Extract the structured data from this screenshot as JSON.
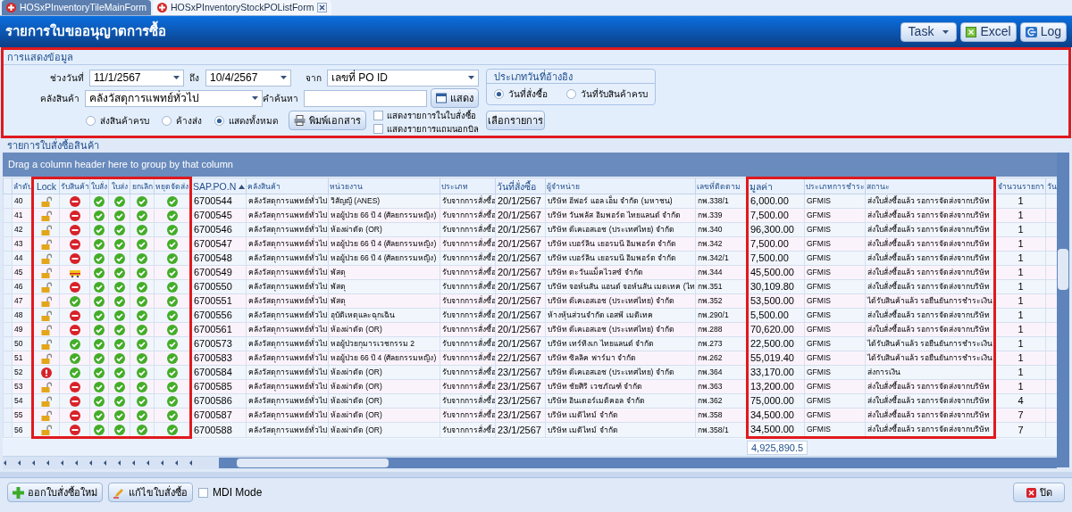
{
  "tabs": [
    {
      "label": "HOSxPInventoryTileMainForm",
      "selected": false,
      "closable": false
    },
    {
      "label": "HOSxPInventoryStockPOListForm",
      "selected": true,
      "closable": true
    }
  ],
  "window": {
    "title": "รายการใบขออนุญาตการซื้อ"
  },
  "toolbar": [
    {
      "label": "Task",
      "kind": "menu"
    },
    {
      "label": "Excel",
      "kind": "excel"
    },
    {
      "label": "Log",
      "kind": "log"
    }
  ],
  "filter_panel": {
    "title": "การแสดงข้อมูล",
    "highlighted": true,
    "date_range": {
      "label": "ช่วงวันที่",
      "from": "11/1/2567",
      "to_label": "ถึง",
      "to": "10/4/2567"
    },
    "source": {
      "label": "จาก",
      "value": "เลขที่ PO ID"
    },
    "warehouse": {
      "label": "คลังสินค้า",
      "value": "คลังวัสดุการแพทย์ทั่วไป"
    },
    "search": {
      "label": "คำค้นหา",
      "button": "แสดง"
    },
    "delivery_filter": [
      {
        "label": "ส่งสินค้าครบ",
        "selected": false
      },
      {
        "label": "ค้างส่ง",
        "selected": false
      },
      {
        "label": "แสดงทั้งหมด",
        "selected": true
      }
    ],
    "print_button": "พิมพ์เอกสาร",
    "options": [
      {
        "label": "แสดงรายการในใบสั่งซื้อ",
        "checked": false
      },
      {
        "label": "แสดงรายการแถมนอกบิล",
        "checked": false
      }
    ],
    "date_type": {
      "title": "ประเภทวันที่อ้างอิง",
      "options": [
        {
          "label": "วันที่สั่งซื้อ",
          "selected": true
        },
        {
          "label": "วันที่รับสินค้าครบ",
          "selected": false
        }
      ]
    },
    "select_button": "เลือกรายการ"
  },
  "grid": {
    "title": "รายการใบสั่งซื้อสินค้า",
    "group_hint": "Drag a column header here to group by that column",
    "columns": [
      {
        "label": "ลำดับ",
        "kind": "text",
        "highlighted": false
      },
      {
        "label": "Lock",
        "kind": "icon",
        "highlighted": true
      },
      {
        "label": "รับสินค้า",
        "kind": "icon",
        "highlighted": true
      },
      {
        "label": "ใบสั่ง",
        "kind": "icon",
        "highlighted": true
      },
      {
        "label": "ใบส่ง",
        "kind": "icon",
        "highlighted": true
      },
      {
        "label": "ยกเลิก",
        "kind": "icon",
        "highlighted": true
      },
      {
        "label": "หยุดจัดส่ง",
        "kind": "icon",
        "highlighted": true
      },
      {
        "label": "SAP.PO.N",
        "kind": "text",
        "highlighted": false,
        "sorted_ascending": true
      },
      {
        "label": "คลังสินค้า",
        "kind": "text",
        "highlighted": false
      },
      {
        "label": "หน่วยงาน",
        "kind": "text",
        "highlighted": false
      },
      {
        "label": "ประเภท",
        "kind": "text",
        "highlighted": false
      },
      {
        "label": "วันที่สั่งซื้อ",
        "kind": "text",
        "highlighted": false
      },
      {
        "label": "ผู้จำหน่าย",
        "kind": "text",
        "highlighted": false
      },
      {
        "label": "เลขที่ติดตาม",
        "kind": "text",
        "highlighted": false
      },
      {
        "label": "มูลค่า",
        "kind": "text",
        "highlighted": true,
        "total": "4,925,890.5"
      },
      {
        "label": "ประเภทการชำระ",
        "kind": "text",
        "highlighted": true
      },
      {
        "label": "สถานะ",
        "kind": "text",
        "highlighted": true
      },
      {
        "label": "จำนวนรายกา",
        "kind": "count",
        "highlighted": false
      },
      {
        "label": "วัน",
        "kind": "text",
        "highlighted": false
      }
    ],
    "rows": [
      {
        "cells": [
          "40",
          {
            "kind": "unlocked"
          },
          {
            "kind": "no"
          },
          {
            "kind": "ok"
          },
          {
            "kind": "ok"
          },
          {
            "kind": "ok"
          },
          {
            "kind": "ok"
          },
          "6700544",
          "คลังวัสดุการแพทย์ทั่วไป",
          "วิสัญญี (ANES)",
          "รับจากการสั่งซื้อ",
          "20/1/2567",
          "บริษัท อีฟอร์ แอล เอ็ม จำกัด (มหาชน)",
          "กพ.338/1",
          "6,000.00",
          "GFMIS",
          "ส่งใบสั่งซื้อแล้ว รอการจัดส่งจากบริษัท",
          "1"
        ]
      },
      {
        "cells": [
          "41",
          {
            "kind": "unlocked"
          },
          {
            "kind": "no"
          },
          {
            "kind": "ok"
          },
          {
            "kind": "ok"
          },
          {
            "kind": "ok"
          },
          {
            "kind": "ok"
          },
          "6700545",
          "คลังวัสดุการแพทย์ทั่วไป",
          "หอผู้ป่วย 66 ปี 4 (ศัลยกรรมหญิง)",
          "รับจากการสั่งซื้อ",
          "20/1/2567",
          "บริษัท วันพลัส อิมพอร์ต ไทยแลนด์ จำกัด",
          "กพ.339",
          "7,500.00",
          "GFMIS",
          "ส่งใบสั่งซื้อแล้ว รอการจัดส่งจากบริษัท",
          "1"
        ]
      },
      {
        "cells": [
          "42",
          {
            "kind": "unlocked"
          },
          {
            "kind": "no"
          },
          {
            "kind": "ok"
          },
          {
            "kind": "ok"
          },
          {
            "kind": "ok"
          },
          {
            "kind": "ok"
          },
          "6700546",
          "คลังวัสดุการแพทย์ทั่วไป",
          "ห้องผ่าตัด (OR)",
          "รับจากการสั่งซื้อ",
          "20/1/2567",
          "บริษัท ดีเคเอสเอช (ประเทศไทย) จำกัด",
          "กพ.340",
          "96,300.00",
          "GFMIS",
          "ส่งใบสั่งซื้อแล้ว รอการจัดส่งจากบริษัท",
          "1"
        ]
      },
      {
        "cells": [
          "43",
          {
            "kind": "unlocked"
          },
          {
            "kind": "no"
          },
          {
            "kind": "ok"
          },
          {
            "kind": "ok"
          },
          {
            "kind": "ok"
          },
          {
            "kind": "ok"
          },
          "6700547",
          "คลังวัสดุการแพทย์ทั่วไป",
          "หอผู้ป่วย 66 ปี 4 (ศัลยกรรมหญิง)",
          "รับจากการสั่งซื้อ",
          "20/1/2567",
          "บริษัท เบอร์ลิน เยอรมนี อิมพอร์ต จำกัด",
          "กพ.342",
          "7,500.00",
          "GFMIS",
          "ส่งใบสั่งซื้อแล้ว รอการจัดส่งจากบริษัท",
          "1"
        ]
      },
      {
        "cells": [
          "44",
          {
            "kind": "unlocked"
          },
          {
            "kind": "no"
          },
          {
            "kind": "ok"
          },
          {
            "kind": "ok"
          },
          {
            "kind": "ok"
          },
          {
            "kind": "ok"
          },
          "6700548",
          "คลังวัสดุการแพทย์ทั่วไป",
          "หอผู้ป่วย 66 ปี 4 (ศัลยกรรมหญิง)",
          "รับจากการสั่งซื้อ",
          "20/1/2567",
          "บริษัท เบอร์ลิน เยอรมนี อิมพอร์ต จำกัด",
          "กพ.342/1",
          "7,500.00",
          "GFMIS",
          "ส่งใบสั่งซื้อแล้ว รอการจัดส่งจากบริษัท",
          "1"
        ]
      },
      {
        "cells": [
          "45",
          {
            "kind": "unlocked"
          },
          {
            "kind": "partial"
          },
          {
            "kind": "ok"
          },
          {
            "kind": "ok"
          },
          {
            "kind": "ok"
          },
          {
            "kind": "ok"
          },
          "6700549",
          "คลังวัสดุการแพทย์ทั่วไป",
          "พัสดุ",
          "รับจากการสั่งซื้อ",
          "20/1/2567",
          "บริษัท ตะวันแม็คไวสซ์ จำกัด",
          "กพ.344",
          "45,500.00",
          "GFMIS",
          "ส่งใบสั่งซื้อแล้ว รอการจัดส่งจากบริษัท",
          "1"
        ]
      },
      {
        "cells": [
          "46",
          {
            "kind": "unlocked"
          },
          {
            "kind": "no"
          },
          {
            "kind": "ok"
          },
          {
            "kind": "ok"
          },
          {
            "kind": "ok"
          },
          {
            "kind": "ok"
          },
          "6700550",
          "คลังวัสดุการแพทย์ทั่วไป",
          "พัสดุ",
          "รับจากการสั่งซื้อ",
          "20/1/2567",
          "บริษัท จอห์นสัน แอนด์ จอห์นสัน เมดเทค (ไท",
          "กพ.351",
          "30,109.80",
          "GFMIS",
          "ส่งใบสั่งซื้อแล้ว รอการจัดส่งจากบริษัท",
          "1"
        ]
      },
      {
        "cells": [
          "47",
          {
            "kind": "unlocked"
          },
          {
            "kind": "ok"
          },
          {
            "kind": "ok"
          },
          {
            "kind": "ok"
          },
          {
            "kind": "ok"
          },
          {
            "kind": "ok"
          },
          "6700551",
          "คลังวัสดุการแพทย์ทั่วไป",
          "พัสดุ",
          "รับจากการสั่งซื้อ",
          "20/1/2567",
          "บริษัท ดีเคเอสเอช (ประเทศไทย) จำกัด",
          "กพ.352",
          "53,500.00",
          "GFMIS",
          "ได้รับสินค้าแล้ว รอยืนยันการชำระเงิน",
          "1"
        ]
      },
      {
        "cells": [
          "48",
          {
            "kind": "unlocked"
          },
          {
            "kind": "no"
          },
          {
            "kind": "ok"
          },
          {
            "kind": "ok"
          },
          {
            "kind": "ok"
          },
          {
            "kind": "ok"
          },
          "6700556",
          "คลังวัสดุการแพทย์ทั่วไป",
          "อุบัติเหตุและฉุกเฉิน",
          "รับจากการสั่งซื้อ",
          "20/1/2567",
          "ห้างหุ้นส่วนจำกัด เอสพี เมดิเทค",
          "กพ.290/1",
          "5,500.00",
          "GFMIS",
          "ส่งใบสั่งซื้อแล้ว รอการจัดส่งจากบริษัท",
          "1"
        ]
      },
      {
        "cells": [
          "49",
          {
            "kind": "unlocked"
          },
          {
            "kind": "no"
          },
          {
            "kind": "ok"
          },
          {
            "kind": "ok"
          },
          {
            "kind": "ok"
          },
          {
            "kind": "ok"
          },
          "6700561",
          "คลังวัสดุการแพทย์ทั่วไป",
          "ห้องผ่าตัด (OR)",
          "รับจากการสั่งซื้อ",
          "20/1/2567",
          "บริษัท ดีเคเอสเอช (ประเทศไทย) จำกัด",
          "กพ.288",
          "70,620.00",
          "GFMIS",
          "ส่งใบสั่งซื้อแล้ว รอการจัดส่งจากบริษัท",
          "1"
        ]
      },
      {
        "cells": [
          "50",
          {
            "kind": "unlocked"
          },
          {
            "kind": "ok"
          },
          {
            "kind": "ok"
          },
          {
            "kind": "ok"
          },
          {
            "kind": "ok"
          },
          {
            "kind": "ok"
          },
          "6700573",
          "คลังวัสดุการแพทย์ทั่วไป",
          "หอผู้ป่วยกุมารเวชกรรม 2",
          "รับจากการสั่งซื้อ",
          "20/1/2567",
          "บริษัท เทร์ทิงเก ไทยแลนด์ จำกัด",
          "กพ.273",
          "22,500.00",
          "GFMIS",
          "ได้รับสินค้าแล้ว รอยืนยันการชำระเงิน",
          "1"
        ]
      },
      {
        "cells": [
          "51",
          {
            "kind": "unlocked"
          },
          {
            "kind": "ok"
          },
          {
            "kind": "ok"
          },
          {
            "kind": "ok"
          },
          {
            "kind": "ok"
          },
          {
            "kind": "ok"
          },
          "6700583",
          "คลังวัสดุการแพทย์ทั่วไป",
          "หอผู้ป่วย 66 ปี 4 (ศัลยกรรมหญิง)",
          "รับจากการสั่งซื้อ",
          "22/1/2567",
          "บริษัท ซิลลิค ฟาร์มา จำกัด",
          "กพ.262",
          "55,019.40",
          "GFMIS",
          "ได้รับสินค้าแล้ว รอยืนยันการชำระเงิน",
          "1"
        ]
      },
      {
        "cells": [
          "52",
          {
            "kind": "alert"
          },
          {
            "kind": "ok"
          },
          {
            "kind": "ok"
          },
          {
            "kind": "ok"
          },
          {
            "kind": "ok"
          },
          {
            "kind": "ok"
          },
          "6700584",
          "คลังวัสดุการแพทย์ทั่วไป",
          "ห้องผ่าตัด (OR)",
          "รับจากการสั่งซื้อ",
          "23/1/2567",
          "บริษัท ดีเคเอสเอช (ประเทศไทย) จำกัด",
          "กพ.364",
          "33,170.00",
          "GFMIS",
          "ส่งการเงิน",
          "1"
        ]
      },
      {
        "cells": [
          "53",
          {
            "kind": "unlocked"
          },
          {
            "kind": "no"
          },
          {
            "kind": "ok"
          },
          {
            "kind": "ok"
          },
          {
            "kind": "ok"
          },
          {
            "kind": "ok"
          },
          "6700585",
          "คลังวัสดุการแพทย์ทั่วไป",
          "ห้องผ่าตัด (OR)",
          "รับจากการสั่งซื้อ",
          "23/1/2567",
          "บริษัท ชัยศิริ เวชภัณฑ์ จำกัด",
          "กพ.363",
          "13,200.00",
          "GFMIS",
          "ส่งใบสั่งซื้อแล้ว รอการจัดส่งจากบริษัท",
          "1"
        ]
      },
      {
        "cells": [
          "54",
          {
            "kind": "unlocked"
          },
          {
            "kind": "no"
          },
          {
            "kind": "ok"
          },
          {
            "kind": "ok"
          },
          {
            "kind": "ok"
          },
          {
            "kind": "ok"
          },
          "6700586",
          "คลังวัสดุการแพทย์ทั่วไป",
          "ห้องผ่าตัด (OR)",
          "รับจากการสั่งซื้อ",
          "23/1/2567",
          "บริษัท อินเตอร์เมดิคอล จำกัด",
          "กพ.362",
          "75,000.00",
          "GFMIS",
          "ส่งใบสั่งซื้อแล้ว รอการจัดส่งจากบริษัท",
          "4"
        ]
      },
      {
        "cells": [
          "55",
          {
            "kind": "unlocked"
          },
          {
            "kind": "no"
          },
          {
            "kind": "ok"
          },
          {
            "kind": "ok"
          },
          {
            "kind": "ok"
          },
          {
            "kind": "ok"
          },
          "6700587",
          "คลังวัสดุการแพทย์ทั่วไป",
          "ห้องผ่าตัด (OR)",
          "รับจากการสั่งซื้อ",
          "23/1/2567",
          "บริษัท เมดิไทม์ จำกัด",
          "กพ.358",
          "34,500.00",
          "GFMIS",
          "ส่งใบสั่งซื้อแล้ว รอการจัดส่งจากบริษัท",
          "7"
        ]
      },
      {
        "cells": [
          "56",
          {
            "kind": "unlocked"
          },
          {
            "kind": "no"
          },
          {
            "kind": "ok"
          },
          {
            "kind": "ok"
          },
          {
            "kind": "ok"
          },
          {
            "kind": "ok"
          },
          "6700588",
          "คลังวัสดุการแพทย์ทั่วไป",
          "ห้องผ่าตัด (OR)",
          "รับจากการสั่งซื้อ",
          "23/1/2567",
          "บริษัท เมดิไทม์ จำกัด",
          "กพ.358/1",
          "34,500.00",
          "GFMIS",
          "ส่งใบสั่งซื้อแล้ว รอการจัดส่งจากบริษัท",
          "7"
        ]
      }
    ]
  },
  "bottom_bar": {
    "new_button": "ออกใบสั่งซื้อใหม่",
    "edit_button": "แก้ไขใบสั่งซื้อ",
    "mdi_mode": {
      "label": "MDI Mode",
      "checked": false
    },
    "close_button": "ปิด"
  }
}
